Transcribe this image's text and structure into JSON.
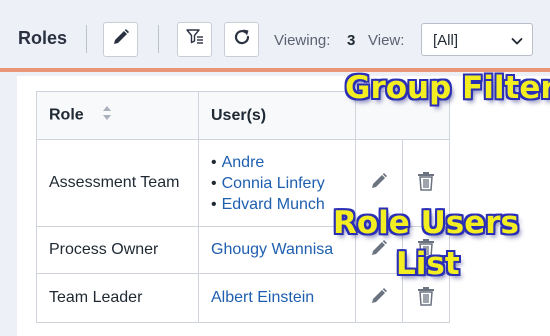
{
  "toolbar": {
    "title": "Roles",
    "edit_icon": "pencil-icon",
    "filter_icon": "filter-list-icon",
    "refresh_icon": "refresh-icon",
    "viewing_label": "Viewing:",
    "viewing_count": "3",
    "view_label": "View:",
    "view_selected": "[All]"
  },
  "table": {
    "headers": {
      "role": "Role",
      "users": "User(s)"
    },
    "rows": [
      {
        "role": "Assessment Team",
        "users": [
          "Andre",
          "Connia Linfery",
          "Edvard Munch"
        ]
      },
      {
        "role": "Process Owner",
        "users": [
          "Ghougy Wannisa"
        ]
      },
      {
        "role": "Team Leader",
        "users": [
          "Albert Einstein"
        ]
      }
    ],
    "row_icons": {
      "edit": "pencil-icon",
      "delete": "trash-icon"
    }
  },
  "annotations": {
    "group_filter": "Group Filter",
    "role_users_line1": "Role Users",
    "role_users_line2": "List"
  },
  "colors": {
    "accent_border": "#e8957a",
    "link": "#1f5fb0",
    "annotation_fill": "#f3ee22",
    "annotation_outline": "#2b2fb5"
  }
}
